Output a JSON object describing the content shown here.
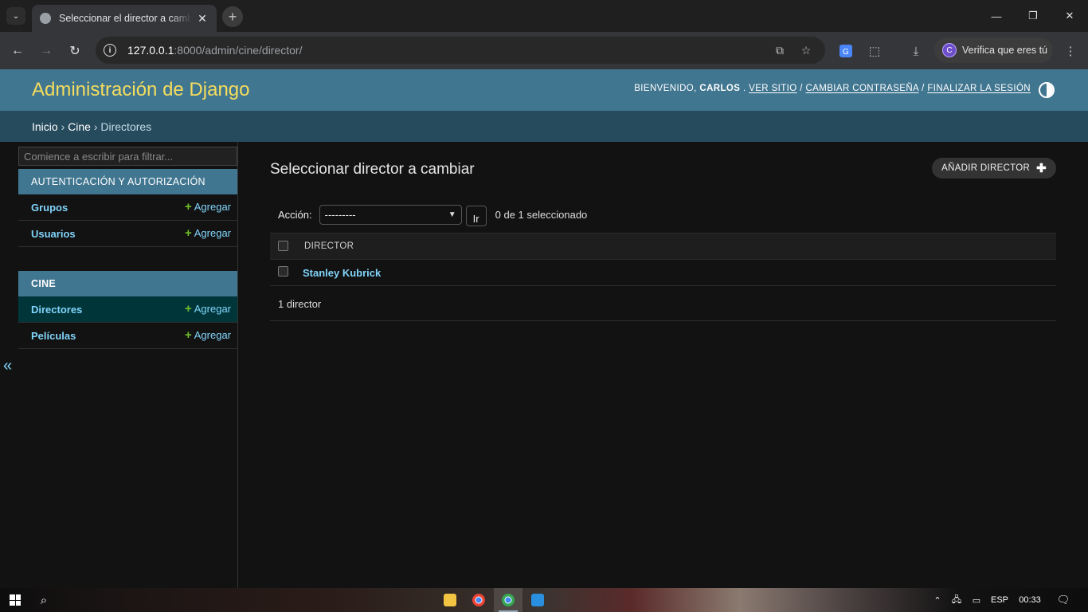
{
  "browser": {
    "tab_title": "Seleccionar el director a cambiar | Sitio de administración de Django",
    "url_host": "127.0.0.1",
    "url_rest": ":8000/admin/cine/director/",
    "profile_label": "Verifica que eres tú",
    "profile_initial": "C"
  },
  "header": {
    "brand": "Administración de Django",
    "welcome": "Bienvenido,",
    "username": "Carlos",
    "sep_dot": ".",
    "view_site": "Ver sitio",
    "sep1": "/",
    "change_password": "Cambiar contraseña",
    "sep2": "/",
    "logout": "Finalizar la sesión"
  },
  "breadcrumbs": {
    "home": "Inicio",
    "sep1": "›",
    "app": "Cine",
    "sep2": "›",
    "current": "Directores"
  },
  "sidebar": {
    "filter_placeholder": "Comience a escribir para filtrar...",
    "apps": [
      {
        "caption": "Autenticación y autorización",
        "models": [
          {
            "name": "Grupos",
            "add": "Agregar"
          },
          {
            "name": "Usuarios",
            "add": "Agregar"
          }
        ]
      },
      {
        "caption": "Cine",
        "models": [
          {
            "name": "Directores",
            "add": "Agregar"
          },
          {
            "name": "Películas",
            "add": "Agregar"
          }
        ]
      }
    ],
    "collapse": "«"
  },
  "content": {
    "title": "Seleccionar director a cambiar",
    "add_button": "Añadir director",
    "action_label": "Acción:",
    "action_selected": "---------",
    "go_button": "Ir",
    "selected_count": "0 de 1 seleccionado",
    "column_header": "Director",
    "rows": [
      "Stanley Kubrick"
    ],
    "paginator": "1 director"
  },
  "taskbar": {
    "language": "ESP",
    "time": "00:33"
  },
  "colors": {
    "header_bg": "#417690",
    "brand": "#f5dd5d",
    "breadcrumbs_bg": "#264b5d",
    "link": "#81d4fa",
    "add_green": "#70bf2b",
    "body_bg": "#121212"
  }
}
